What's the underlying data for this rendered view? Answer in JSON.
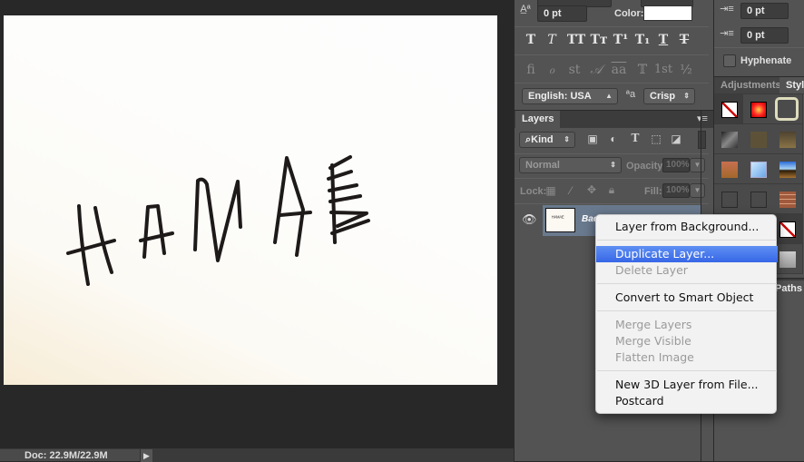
{
  "canvas": {
    "drawing_text": "HAMAE",
    "status": {
      "doc_info": "Doc: 22.9M/22.9M",
      "menu_arrow": "▶"
    }
  },
  "character_panel": {
    "baseline_shift": "0 pt",
    "color_label": "Color:",
    "color_value": "#ffffff",
    "type_styles": [
      "T",
      "T",
      "TT",
      "Tт",
      "T¹",
      "T₁",
      "T",
      "T"
    ],
    "opentype": [
      "ﬁ",
      "ℴ",
      "st",
      "𝒜",
      "aa",
      "𝕋",
      "1st",
      "½"
    ],
    "language": "English: USA",
    "aa_icon": "ªa",
    "antialias": "Crisp"
  },
  "paragraph_panel": {
    "space_before": "0 pt",
    "space_after": "0 pt",
    "hyphenate_label": "Hyphenate"
  },
  "tabs_right": [
    "Adjustments",
    "Styles"
  ],
  "layers_panel": {
    "tab": "Layers",
    "filter_kind": "Kind",
    "blend_mode": "Normal",
    "opacity_label": "Opacity:",
    "opacity_value": "100%",
    "lock_label": "Lock:",
    "fill_label": "Fill:",
    "fill_value": "100%",
    "layer_name": "Background",
    "layer_name_visible": "Bac"
  },
  "paths_tab": "Paths",
  "context_menu": {
    "items": [
      {
        "label": "Layer from Background...",
        "state": "enabled"
      },
      {
        "label": "Duplicate Layer...",
        "state": "highlighted"
      },
      {
        "label": "Delete Layer",
        "state": "disabled"
      },
      {
        "label": "Convert to Smart Object",
        "state": "enabled"
      },
      {
        "label": "Merge Layers",
        "state": "disabled"
      },
      {
        "label": "Merge Visible",
        "state": "disabled"
      },
      {
        "label": "Flatten Image",
        "state": "disabled"
      },
      {
        "label": "New 3D Layer from File...",
        "state": "enabled"
      },
      {
        "label": "Postcard",
        "state": "enabled"
      }
    ]
  },
  "colors": {
    "menu_highlight": "#3f6fe8",
    "panel_bg": "#535353",
    "layer_selected": "#6a7a8e"
  }
}
